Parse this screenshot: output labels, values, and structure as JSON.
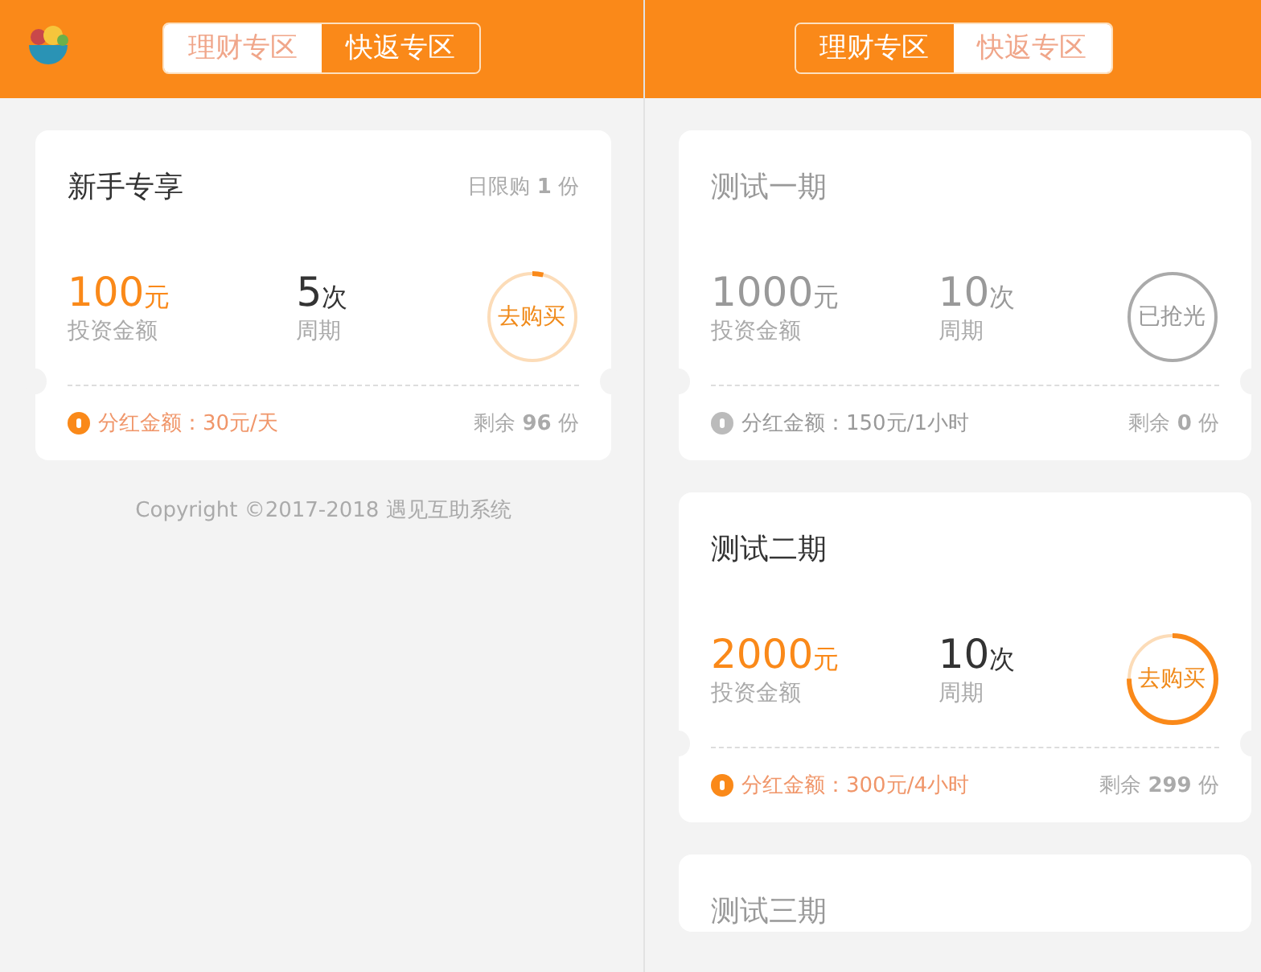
{
  "screens": [
    {
      "logo": true,
      "tabs": [
        {
          "label": "理财专区",
          "selected": false
        },
        {
          "label": "快返专区",
          "selected": true
        }
      ],
      "products": [
        {
          "title": "新手专享",
          "kind": "available",
          "limit": "日限购 **1** 份",
          "amount": "100",
          "amount_unit": "元",
          "amount_label": "投资金额",
          "period": "5",
          "period_unit": "次",
          "period_label": "周期",
          "action": "去购买",
          "level": 0.04,
          "dividend": "分红金额：30元/天",
          "remaining": "剩余 **96** 份"
        }
      ],
      "copyright": "Copyright ©2017-2018 遇见互助系统"
    },
    {
      "logo": false,
      "tabs": [
        {
          "label": "理财专区",
          "selected": true
        },
        {
          "label": "快返专区",
          "selected": false
        }
      ],
      "products": [
        {
          "title": "测试一期",
          "kind": "sold_out",
          "amount": "1000",
          "amount_unit": "元",
          "amount_label": "投资金额",
          "period": "10",
          "period_unit": "次",
          "period_label": "周期",
          "action": "已抢光",
          "dividend": "分红金额：150元/1小时",
          "remaining": "剩余 **0** 份"
        },
        {
          "title": "测试二期",
          "kind": "available",
          "amount": "2000",
          "amount_unit": "元",
          "amount_label": "投资金额",
          "period": "10",
          "period_unit": "次",
          "period_label": "周期",
          "action": "去购买",
          "level": 0.75,
          "dividend": "分红金额：300元/4小时",
          "remaining": "剩余 **299** 份"
        },
        {
          "title": "测试三期",
          "kind": "sold_out"
        }
      ]
    }
  ]
}
